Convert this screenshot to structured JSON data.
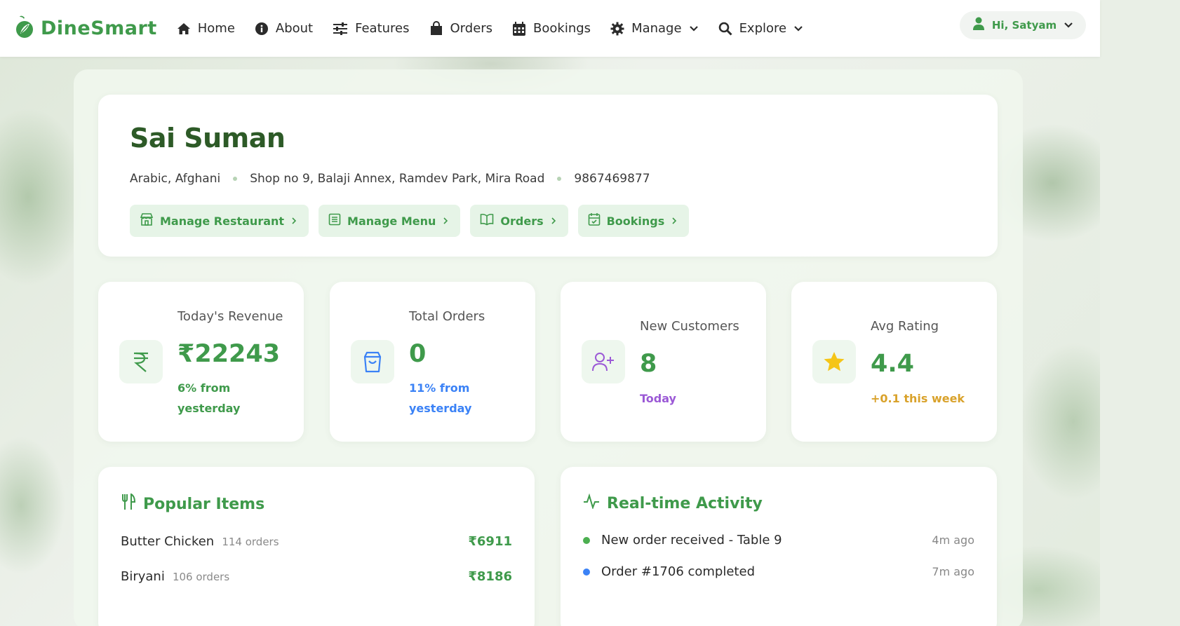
{
  "brand": {
    "name": "DineSmart",
    "logo_icon": "leaf-logo-icon",
    "color": "#3f9a4b"
  },
  "nav": [
    {
      "label": "Home",
      "icon": "home-icon"
    },
    {
      "label": "About",
      "icon": "info-icon"
    },
    {
      "label": "Features",
      "icon": "sliders-icon"
    },
    {
      "label": "Orders",
      "icon": "shopping-bag-icon"
    },
    {
      "label": "Bookings",
      "icon": "calendar-icon"
    },
    {
      "label": "Manage",
      "icon": "gear-icon",
      "dropdown": true
    },
    {
      "label": "Explore",
      "icon": "search-icon",
      "dropdown": true
    }
  ],
  "user": {
    "greeting": "Hi, Satyam",
    "icon": "user-icon"
  },
  "restaurant": {
    "name": "Sai Suman",
    "cuisine": "Arabic, Afghani",
    "address": "Shop no 9, Balaji Annex, Ramdev Park, Mira Road",
    "phone": "9867469877"
  },
  "quick_actions": [
    {
      "label": "Manage Restaurant",
      "icon": "store-icon"
    },
    {
      "label": "Manage Menu",
      "icon": "list-icon"
    },
    {
      "label": "Orders",
      "icon": "book-open-icon"
    },
    {
      "label": "Bookings",
      "icon": "calendar-check-icon"
    }
  ],
  "stats": [
    {
      "label": "Today's Revenue",
      "value": "₹22243",
      "sub": "6% from yesterday",
      "sub_color": "#3f9a4b",
      "icon": "rupee-icon"
    },
    {
      "label": "Total Orders",
      "value": "0",
      "sub": "11% from yesterday",
      "sub_color": "#3b82f6",
      "icon": "shopping-bag-icon"
    },
    {
      "label": "New Customers",
      "value": "8",
      "sub": "Today",
      "sub_color": "#9b59d6",
      "icon": "user-plus-icon"
    },
    {
      "label": "Avg Rating",
      "value": "4.4",
      "sub": "+0.1 this week",
      "sub_color": "#d9a22b",
      "icon": "star-icon"
    }
  ],
  "popular": {
    "title": "Popular Items",
    "items": [
      {
        "name": "Butter Chicken",
        "count": "114 orders",
        "price": "₹6911"
      },
      {
        "name": "Biryani",
        "count": "106 orders",
        "price": "₹8186"
      }
    ]
  },
  "activity": {
    "title": "Real-time Activity",
    "items": [
      {
        "text": "New order received - Table 9",
        "time": "4m ago",
        "dot_color": "#4caf50"
      },
      {
        "text": "Order #1706 completed",
        "time": "7m ago",
        "dot_color": "#3b82f6"
      }
    ]
  }
}
